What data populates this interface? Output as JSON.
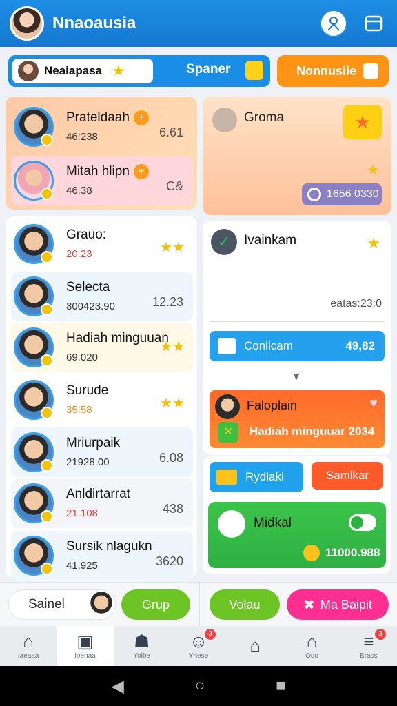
{
  "header": {
    "title": "Nnaoausia"
  },
  "top": {
    "search_value": "Neaiapasa",
    "spanner_label": "Spaner",
    "orange_label": "Nonnusiie"
  },
  "featured": [
    {
      "name": "Prateldaah",
      "sub": "46:238",
      "value": "6.61"
    },
    {
      "name": "Mitah hlipn",
      "sub": "46.38",
      "value": "C&"
    }
  ],
  "group_card": {
    "title": "Groma",
    "pill": "1656 0330"
  },
  "friends": [
    {
      "name": "Grauo:",
      "sub": "20.23",
      "value": ""
    },
    {
      "name": "Selecta",
      "sub": "300423.90",
      "value": "12.23"
    },
    {
      "name": "Hadiah minguuan",
      "sub": "69.020",
      "value": ""
    },
    {
      "name": "Surude",
      "sub": "35:58",
      "value": ""
    },
    {
      "name": "Mriurpaik",
      "sub": "21928.00",
      "value": "6.08"
    },
    {
      "name": "Anldirtarrat",
      "sub": "21.108",
      "value": "438"
    },
    {
      "name": "Sursik nlagukn",
      "sub": "41.925",
      "value": "3620"
    }
  ],
  "ranking": {
    "title": "Ivainkam",
    "stat": "eatas:23:0",
    "blue_label": "Conlicam",
    "blue_value": "49,82",
    "orange_title": "Faloplain",
    "orange_sub": "Hadiah minguuar 2034"
  },
  "rewards": {
    "btn1": "Rydiaki",
    "btn2": "Samlkar",
    "green_label": "Midkal",
    "amount": "11000.988"
  },
  "actionbar": {
    "input_value": "Sainel",
    "grup": "Grup",
    "vola": "Volau",
    "mab": "Ma Baipit"
  },
  "nav": [
    {
      "label": "Iaeaaa",
      "icon": "home-icon",
      "badge": ""
    },
    {
      "label": "Ioenaa",
      "icon": "inbox-icon",
      "badge": ""
    },
    {
      "label": "Yolbe",
      "icon": "house-icon",
      "badge": ""
    },
    {
      "label": "Yhese",
      "icon": "user-icon",
      "badge": "3"
    },
    {
      "label": "",
      "icon": "home-outline-icon",
      "badge": ""
    },
    {
      "label": "Odo",
      "icon": "building-icon",
      "badge": ""
    },
    {
      "label": "Brass",
      "icon": "menu-icon",
      "badge": "3"
    }
  ],
  "colors": {
    "primary": "#1578cf",
    "orange": "#ff9414",
    "green": "#2fb043",
    "pink": "#ff2f92"
  }
}
